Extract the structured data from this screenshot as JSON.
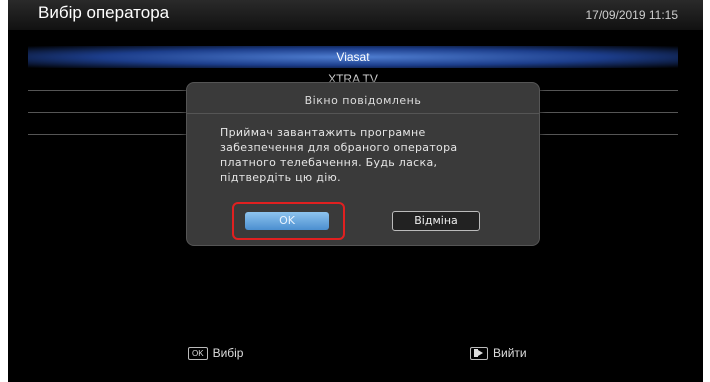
{
  "header": {
    "title": "Вибір оператора",
    "datetime": "17/09/2019 11:15"
  },
  "operators": {
    "items": [
      {
        "label": "Viasat",
        "selected": true
      },
      {
        "label": "XTRA TV",
        "selected": false
      },
      {
        "label": "",
        "selected": false
      },
      {
        "label": "",
        "selected": false
      }
    ]
  },
  "dialog": {
    "title": "Вікно повідомлень",
    "line1": "Приймач завантажить програмне",
    "line2": "забезпечення для обраного оператора",
    "line3": "платного телебачення. Будь ласка,",
    "line4": "підтвердіть цю дію.",
    "ok_label": "OK",
    "cancel_label": "Відміна"
  },
  "footer": {
    "ok_key": "OK",
    "select_label": "Вибір",
    "exit_label": "Вийти"
  },
  "colors": {
    "highlight": "#e02020",
    "selection": "#1c3d8a"
  }
}
